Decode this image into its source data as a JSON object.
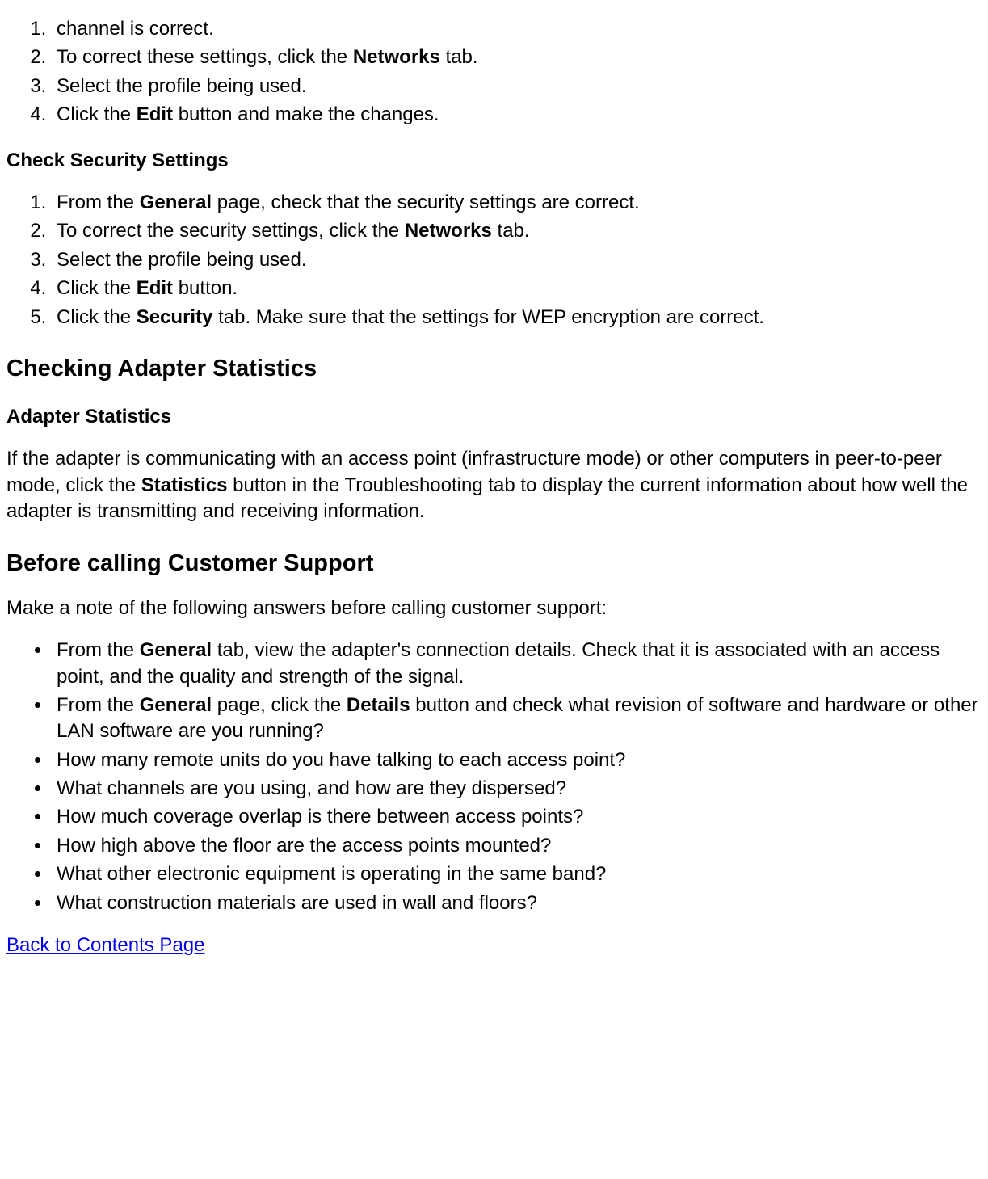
{
  "ol1": {
    "item1": {
      "text": "channel is correct."
    },
    "item2": {
      "pre": "To correct these settings, click the ",
      "b": "Networks",
      "post": " tab."
    },
    "item3": {
      "text": "Select the profile being used."
    },
    "item4": {
      "pre": "Click the ",
      "b": "Edit",
      "post": " button and make the changes."
    }
  },
  "h3_security": "Check Security Settings",
  "ol2": {
    "item1": {
      "pre": "From the ",
      "b": "General",
      "post": " page, check that the security settings are correct."
    },
    "item2": {
      "pre": "To correct the security settings, click the ",
      "b": "Networks",
      "post": " tab."
    },
    "item3": {
      "text": "Select the profile being used."
    },
    "item4": {
      "pre": "Click the ",
      "b": "Edit",
      "post": " button."
    },
    "item5": {
      "pre": "Click the ",
      "b": "Security",
      "post": " tab. Make sure that the settings for WEP encryption are correct."
    }
  },
  "h2_stats": "Checking Adapter Statistics",
  "h3_stats": "Adapter Statistics",
  "p_stats": {
    "pre": "If the adapter is communicating with an access point (infrastructure mode) or other computers in peer-to-peer mode, click the ",
    "b": "Statistics",
    "post": " button in the Troubleshooting tab to display the current information about how well the adapter is transmitting and receiving information."
  },
  "h2_support": "Before calling Customer Support",
  "p_support": "Make a note of the following answers before calling customer support:",
  "ul": {
    "item1": {
      "pre": "From the ",
      "b": "General",
      "post": " tab, view the adapter's connection details. Check that it is associated with an access point, and the quality and strength of the signal."
    },
    "item2": {
      "pre": "From the ",
      "b1": "General",
      "mid": " page, click the ",
      "b2": "Details",
      "post": " button and check what revision of software and hardware or other LAN software are you running?"
    },
    "item3": {
      "text": "How many remote units do you have talking to each access point?"
    },
    "item4": {
      "text": "What channels are you using, and how are they dispersed?"
    },
    "item5": {
      "text": "How much coverage overlap is there between access points?"
    },
    "item6": {
      "text": "How high above the floor are the access points mounted?"
    },
    "item7": {
      "text": "What other electronic equipment is operating in the same band?"
    },
    "item8": {
      "text": "What construction materials are used in wall and floors?"
    }
  },
  "back_link": "Back to Contents Page"
}
